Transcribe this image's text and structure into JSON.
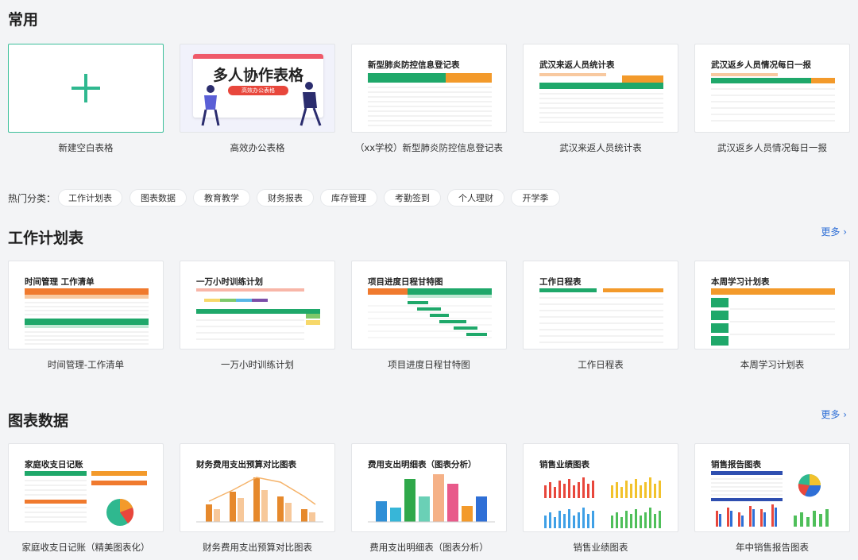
{
  "sections": {
    "common": {
      "title": "常用",
      "cards": [
        {
          "caption": "新建空白表格",
          "thumb_title": ""
        },
        {
          "caption": "高效办公表格",
          "thumb_title": "多人协作表格",
          "thumb_badge": "高效办公表格"
        },
        {
          "caption": "（xx学校）新型肺炎防控信息登记表",
          "thumb_title": "新型肺炎防控信息登记表"
        },
        {
          "caption": "武汉来返人员统计表",
          "thumb_title": "武汉来返人员统计表"
        },
        {
          "caption": "武汉返乡人员情况每日一报",
          "thumb_title": "武汉返乡人员情况每日一报"
        }
      ]
    },
    "hot": {
      "label": "热门分类：",
      "tags": [
        "工作计划表",
        "图表数据",
        "教育教学",
        "财务报表",
        "库存管理",
        "考勤签到",
        "个人理财",
        "开学季"
      ]
    },
    "work_plan": {
      "title": "工作计划表",
      "more": "更多 ›",
      "cards": [
        {
          "caption": "时间管理-工作清单",
          "thumb_title": "时间管理 工作清单"
        },
        {
          "caption": "一万小时训练计划",
          "thumb_title": "一万小时训练计划"
        },
        {
          "caption": "项目进度日程甘特图",
          "thumb_title": "项目进度日程甘特图"
        },
        {
          "caption": "工作日程表",
          "thumb_title": "工作日程表"
        },
        {
          "caption": "本周学习计划表",
          "thumb_title": "本周学习计划表"
        }
      ]
    },
    "charts": {
      "title": "图表数据",
      "more": "更多 ›",
      "cards": [
        {
          "caption": "家庭收支日记账（精美图表化）",
          "thumb_title": "家庭收支日记账"
        },
        {
          "caption": "财务费用支出预算对比图表",
          "thumb_title": "财务费用支出预算对比图表"
        },
        {
          "caption": "费用支出明细表（图表分析）",
          "thumb_title": "费用支出明细表（图表分析）"
        },
        {
          "caption": "销售业绩图表",
          "thumb_title": "销售业绩图表"
        },
        {
          "caption": "年中销售报告图表",
          "thumb_title": "销售报告图表"
        }
      ]
    }
  },
  "colors": {
    "accent": "#2fb88f",
    "link": "#2f6fd6",
    "orange": "#f39a2b",
    "green": "#1fa86a",
    "red": "#e8473c"
  }
}
